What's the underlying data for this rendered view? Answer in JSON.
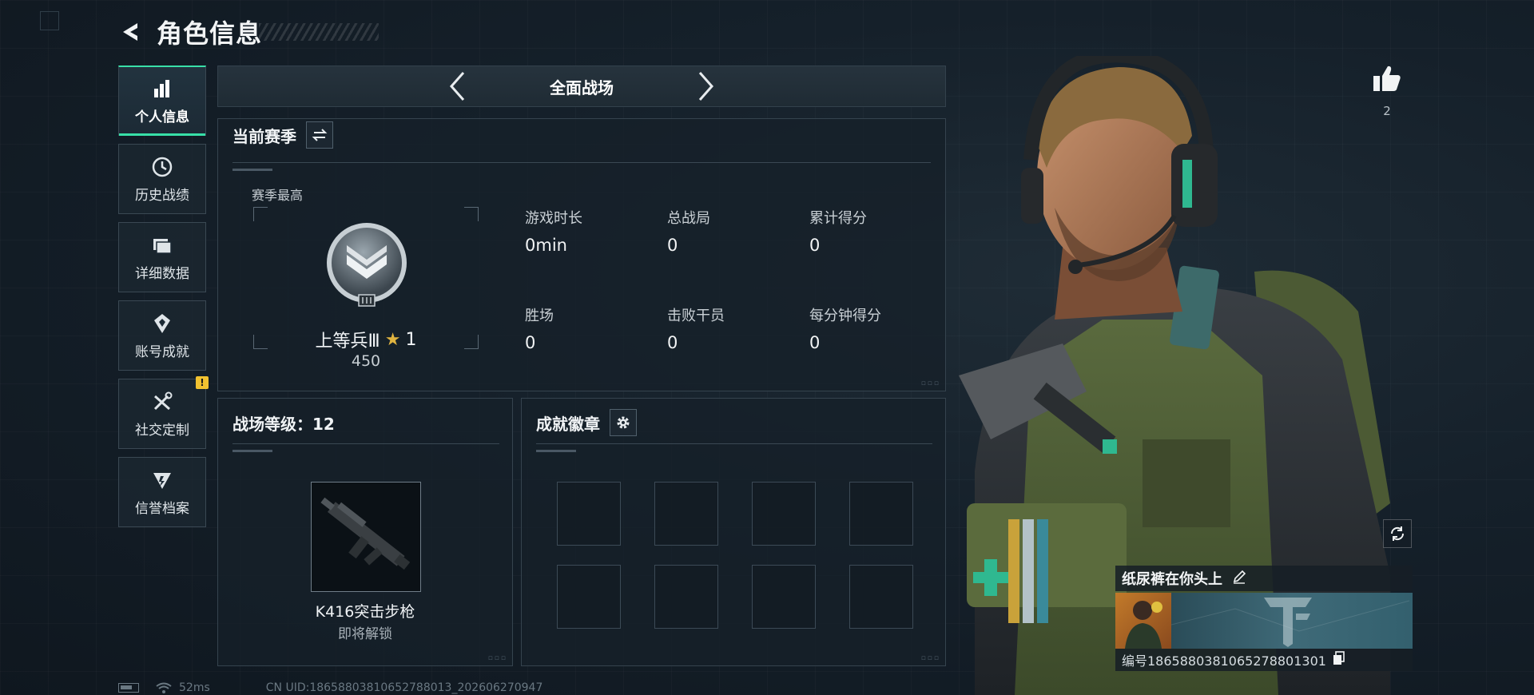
{
  "header": {
    "title": "角色信息"
  },
  "sidebar": {
    "items": [
      {
        "label": "个人信息",
        "icon": "bar-chart-icon",
        "active": true
      },
      {
        "label": "历史战绩",
        "icon": "history-icon"
      },
      {
        "label": "详细数据",
        "icon": "folder-icon"
      },
      {
        "label": "账号成就",
        "icon": "achievement-icon"
      },
      {
        "label": "社交定制",
        "icon": "tools-icon",
        "badge": "!"
      },
      {
        "label": "信誉档案",
        "icon": "credit-icon"
      }
    ]
  },
  "mode": {
    "title": "全面战场"
  },
  "season": {
    "title": "当前赛季",
    "best_label": "赛季最高",
    "rank_name": "上等兵Ⅲ",
    "rank_star_count": "1",
    "rank_points": "450",
    "stats": [
      {
        "label": "游戏时长",
        "value": "0min"
      },
      {
        "label": "总战局",
        "value": "0"
      },
      {
        "label": "累计得分",
        "value": "0"
      },
      {
        "label": "胜场",
        "value": "0"
      },
      {
        "label": "击败干员",
        "value": "0"
      },
      {
        "label": "每分钟得分",
        "value": "0"
      }
    ]
  },
  "battlefield": {
    "title": "战场等级：12",
    "weapon_name": "K416突击步枪",
    "weapon_status": "即将解锁"
  },
  "badges": {
    "title": "成就徽章"
  },
  "footer": {
    "ping": "52ms",
    "uid": "CN UID:18658803810652788013_202606270947"
  },
  "likes": {
    "count": "2"
  },
  "player": {
    "name": "纸尿裤在你头上",
    "id_text": "编号1865880381065278801301"
  },
  "colors": {
    "accent": "#38e0a8",
    "warning": "#f2c230",
    "panel_border": "#35434e"
  }
}
